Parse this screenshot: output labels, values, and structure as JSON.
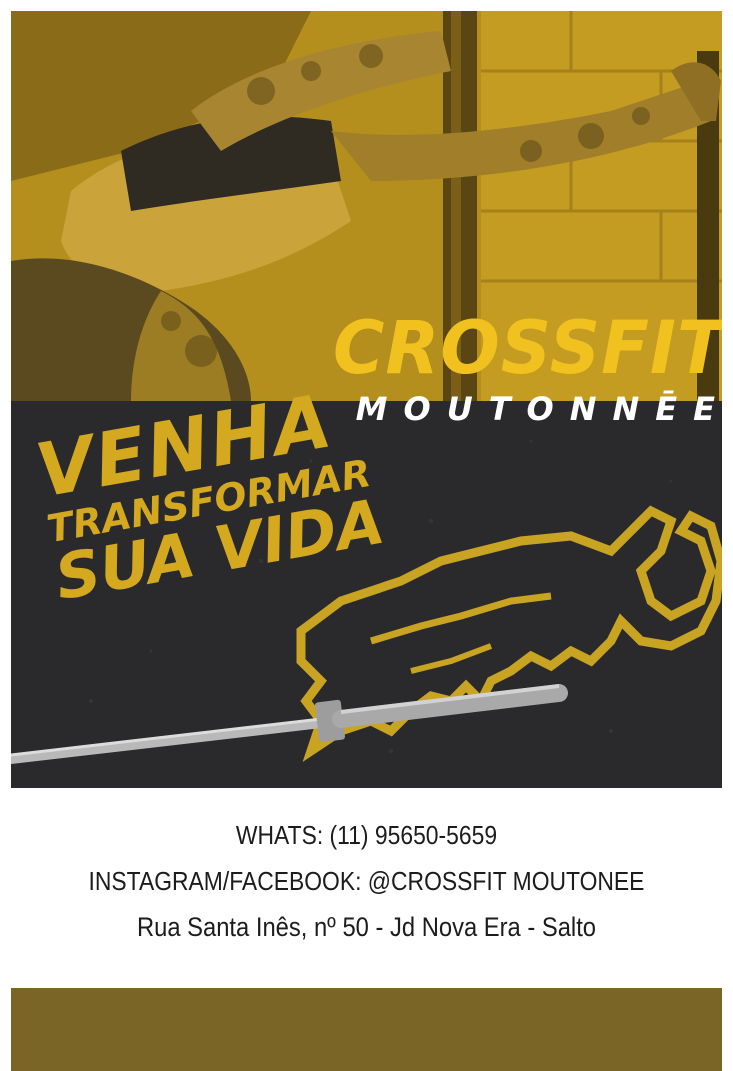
{
  "brand": {
    "title": "CROSSFIT",
    "subtitle": "MOUTONNĒE"
  },
  "slogan": {
    "line1": "VENHA",
    "line2": "TRANSFORMAR",
    "line3": "SUA VIDA"
  },
  "contact": {
    "whatsapp": "WHATS: (11) 95650-5659",
    "social": "INSTAGRAM/FACEBOOK: @CROSSFIT MOUTONEE",
    "address": "Rua Santa Inês, nº 50 - Jd Nova Era - Salto"
  },
  "images": {
    "photo": "athlete-pullup-photo",
    "mascot": "mammoth-logo-icon",
    "barbell": "barbell-icon"
  },
  "colors": {
    "photo_tint": "#b08c1c",
    "dark_bg": "#2b2b2e",
    "accent_yellow": "#f1c21f",
    "footer": "#7a6527"
  }
}
